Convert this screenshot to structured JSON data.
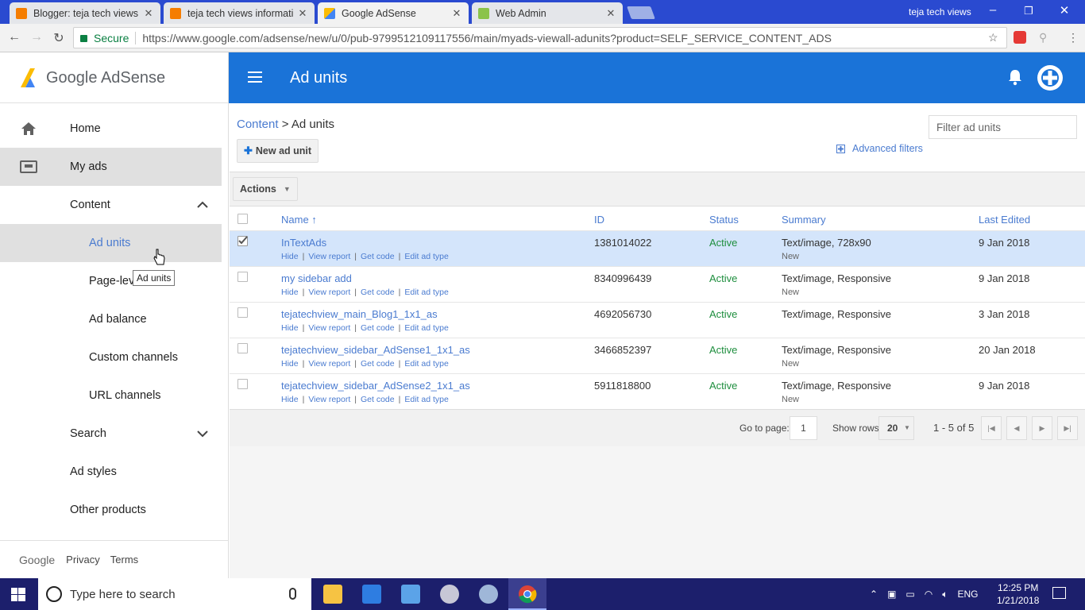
{
  "browser": {
    "tabs": [
      {
        "title": "Blogger: teja tech views",
        "favicon_color": "#f57d00"
      },
      {
        "title": "teja tech views informati",
        "favicon_color": "#f57d00"
      },
      {
        "title": "Google AdSense",
        "favicon_color": "#fbbc04"
      },
      {
        "title": "Web Admin",
        "favicon_color": "#8bc34a"
      }
    ],
    "profile_name": "teja tech views",
    "secure_label": "Secure",
    "url": "https://www.google.com/adsense/new/u/0/pub-9799512109117556/main/myads-viewall-adunits?product=SELF_SERVICE_CONTENT_ADS"
  },
  "sidebar": {
    "logo_text": "Google AdSense",
    "items": [
      {
        "label": "Home",
        "icon": "home-icon"
      },
      {
        "label": "My ads",
        "icon": "ads-icon"
      },
      {
        "label": "Content"
      },
      {
        "label": "Ad units"
      },
      {
        "label": "Page-lev"
      },
      {
        "label": "Ad balance"
      },
      {
        "label": "Custom channels"
      },
      {
        "label": "URL channels"
      },
      {
        "label": "Search"
      },
      {
        "label": "Ad styles"
      },
      {
        "label": "Other products"
      }
    ],
    "tooltip": "Ad units",
    "footer": {
      "google": "Google",
      "privacy": "Privacy",
      "terms": "Terms"
    }
  },
  "header": {
    "title": "Ad units"
  },
  "main": {
    "breadcrumb_link": "Content",
    "breadcrumb_current": "> Ad units",
    "new_ad_unit": "New ad unit",
    "filter_placeholder": "Filter ad units",
    "advanced_filters": "Advanced filters",
    "actions": "Actions",
    "columns": {
      "name": "Name ↑",
      "id": "ID",
      "status": "Status",
      "summary": "Summary",
      "last_edited": "Last Edited"
    },
    "row_links": [
      "Hide",
      "View report",
      "Get code",
      "Edit ad type"
    ],
    "rows": [
      {
        "name": "InTextAds",
        "id": "1381014022",
        "status": "Active",
        "summary": "Text/image, 728x90",
        "new": "New",
        "edited": "9 Jan 2018",
        "selected": true
      },
      {
        "name": "my sidebar add",
        "id": "8340996439",
        "status": "Active",
        "summary": "Text/image, Responsive",
        "new": "New",
        "edited": "9 Jan 2018",
        "selected": false
      },
      {
        "name": "tejatechview_main_Blog1_1x1_as",
        "id": "4692056730",
        "status": "Active",
        "summary": "Text/image, Responsive",
        "new": "",
        "edited": "3 Jan 2018",
        "selected": false
      },
      {
        "name": "tejatechview_sidebar_AdSense1_1x1_as",
        "id": "3466852397",
        "status": "Active",
        "summary": "Text/image, Responsive",
        "new": "New",
        "edited": "20 Jan 2018",
        "selected": false
      },
      {
        "name": "tejatechview_sidebar_AdSense2_1x1_as",
        "id": "5911818800",
        "status": "Active",
        "summary": "Text/image, Responsive",
        "new": "New",
        "edited": "9 Jan 2018",
        "selected": false
      }
    ],
    "pager": {
      "goto_label": "Go to page:",
      "page": "1",
      "rows_label": "Show rows",
      "rows": "20",
      "range": "1 - 5 of 5"
    }
  },
  "taskbar": {
    "search_placeholder": "Type here to search",
    "lang": "ENG",
    "time": "12:25 PM",
    "date": "1/21/2018"
  },
  "colors": {
    "accent": "#1a73d8",
    "link": "#4a7bd0",
    "active_status": "#1e8e3e",
    "selected_row": "#d4e5fb"
  }
}
